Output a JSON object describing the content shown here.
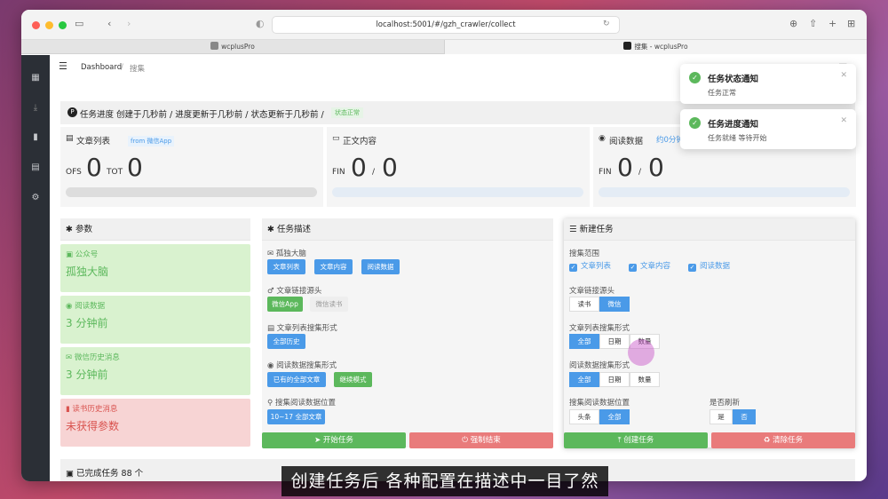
{
  "browser": {
    "url": "localhost:5001/#/gzh_crawler/collect",
    "tab1": "wcplusPro",
    "tab2": "搜集 - wcplusPro"
  },
  "breadcrumb": {
    "home": "Dashboard",
    "sep": "/",
    "current": "搜集"
  },
  "progress": {
    "title": "任务进度 创建于几秒前 / 进度更新于几秒前 / 状态更新于几秒前 /",
    "status": "状态正常"
  },
  "stats": [
    {
      "title": "文章列表",
      "tag": "from 微信App",
      "l1": "OFS",
      "v1": "0",
      "l2": "TOT",
      "v2": "0",
      "progress": 0
    },
    {
      "title": "正文内容",
      "l1": "FIN",
      "v1": "0",
      "sep": "/",
      "v2": "0",
      "progress": 0
    },
    {
      "title": "阅读数据",
      "tag": "约0分钟",
      "l1": "FIN",
      "v1": "0",
      "sep": "/",
      "v2": "0",
      "progress": 0
    }
  ],
  "params": {
    "title": "参数",
    "items": [
      {
        "label": "公众号",
        "value": "孤独大脑"
      },
      {
        "label": "阅读数据",
        "value": "3 分钟前"
      },
      {
        "label": "微信历史消息",
        "value": "3 分钟前"
      },
      {
        "label": "读书历史消息",
        "value": "未获得参数"
      }
    ]
  },
  "desc": {
    "title": "任务描述",
    "g1": {
      "label": "孤独大脑",
      "opts": [
        "文章列表",
        "文章内容",
        "阅读数据"
      ]
    },
    "g2": {
      "label": "文章链接源头",
      "opts": [
        "微信App",
        "微信读书"
      ]
    },
    "g3": {
      "label": "文章列表搜集形式",
      "opts": [
        "全部历史"
      ]
    },
    "g4": {
      "label": "阅读数据搜集形式",
      "opts": [
        "已有的全部文章",
        "继续模式"
      ]
    },
    "g5": {
      "label": "搜集阅读数据位置",
      "opts": [
        "10~17 全部文章"
      ]
    },
    "start": "开始任务",
    "stop": "强制结束"
  },
  "create": {
    "title": "新建任务",
    "scope": {
      "label": "搜集范围",
      "opts": [
        "文章列表",
        "文章内容",
        "阅读数据"
      ]
    },
    "source": {
      "label": "文章链接源头",
      "opts": [
        "读书",
        "微信"
      ]
    },
    "listmode": {
      "label": "文章列表搜集形式",
      "opts": [
        "全部",
        "日期",
        "数量"
      ]
    },
    "readmode": {
      "label": "阅读数据搜集形式",
      "opts": [
        "全部",
        "日期",
        "数量"
      ]
    },
    "pos": {
      "label": "搜集阅读数据位置",
      "opts": [
        "头条",
        "全部"
      ]
    },
    "refresh": {
      "label": "是否刷新",
      "opts": [
        "是",
        "否"
      ]
    },
    "create_btn": "创建任务",
    "clear_btn": "清除任务"
  },
  "done": {
    "title": "已完成任务 88 个"
  },
  "toasts": [
    {
      "title": "任务状态通知",
      "body": "任务正常"
    },
    {
      "title": "任务进度通知",
      "body": "任务就绪 等待开始"
    }
  ],
  "caption": "创建任务后 各种配置在描述中一目了然",
  "colors": {
    "accent": "#4a9ae8",
    "success": "#5cb85c",
    "danger": "#e97b7b",
    "sidebar": "#2b2f36"
  }
}
